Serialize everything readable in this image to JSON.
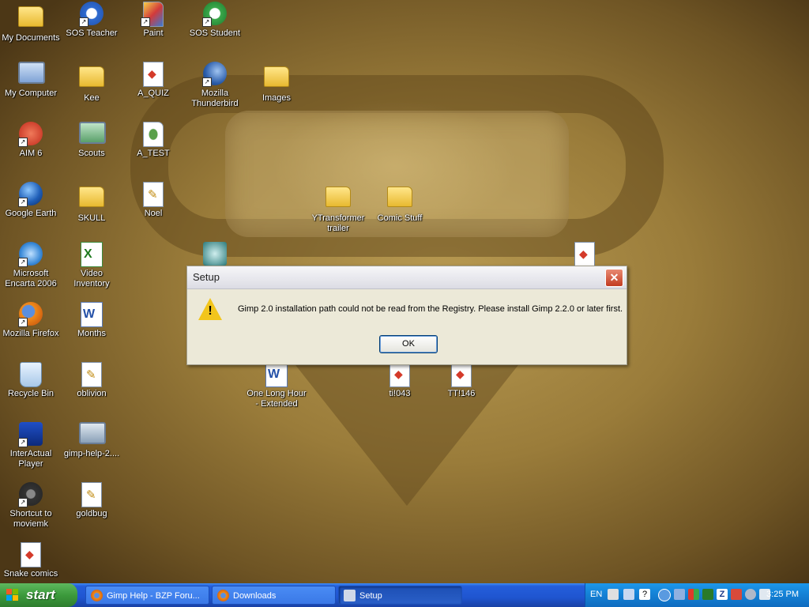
{
  "desktop": {
    "icons": [
      {
        "label": "My Documents",
        "icon": "folder-documents-icon"
      },
      {
        "label": "SOS Teacher",
        "icon": "sos-teacher-icon"
      },
      {
        "label": "Paint",
        "icon": "paint-icon"
      },
      {
        "label": "SOS Student",
        "icon": "sos-student-icon"
      },
      {
        "label": "My Computer",
        "icon": "computer-icon"
      },
      {
        "label": "Kee",
        "icon": "folder-icon"
      },
      {
        "label": "A_QUIZ",
        "icon": "media-file-icon"
      },
      {
        "label": "Mozilla\nThunderbird",
        "icon": "thunderbird-icon"
      },
      {
        "label": "Images",
        "icon": "folder-icon"
      },
      {
        "label": "AIM 6",
        "icon": "aim-icon"
      },
      {
        "label": "Scouts",
        "icon": "computer-icon"
      },
      {
        "label": "A_TEST",
        "icon": "media-player-file-icon"
      },
      {
        "label": "Google Earth",
        "icon": "google-earth-icon"
      },
      {
        "label": "SKULL",
        "icon": "folder-icon"
      },
      {
        "label": "Noel",
        "icon": "text-file-icon"
      },
      {
        "label": "YTransformer\ntrailer",
        "icon": "folder-icon"
      },
      {
        "label": "Comic Stuff",
        "icon": "folder-icon"
      },
      {
        "label": "Microsoft\nEncarta 2006",
        "icon": "encarta-icon"
      },
      {
        "label": "Video\nInventory",
        "icon": "excel-file-icon"
      },
      {
        "label": "Mozilla Firefox",
        "icon": "firefox-icon"
      },
      {
        "label": "Months",
        "icon": "word-file-icon"
      },
      {
        "label": "Recycle Bin",
        "icon": "recycle-bin-icon"
      },
      {
        "label": "oblivion",
        "icon": "text-file-icon"
      },
      {
        "label": "One Long Hour\n- Extended",
        "icon": "word-file-icon"
      },
      {
        "label": "ti!043",
        "icon": "media-file-icon"
      },
      {
        "label": "TT!146",
        "icon": "media-file-icon"
      },
      {
        "label": "InterActual\nPlayer",
        "icon": "interactual-icon"
      },
      {
        "label": "gimp-help-2....",
        "icon": "installer-icon"
      },
      {
        "label": "Shortcut to\nmoviemk",
        "icon": "movie-maker-icon"
      },
      {
        "label": "goldbug",
        "icon": "text-file-icon"
      },
      {
        "label": "Snake comics",
        "icon": "media-file-icon"
      }
    ]
  },
  "dialog": {
    "title": "Setup",
    "message": "Gimp 2.0 installation path could not be read from the Registry. Please install Gimp 2.2.0 or later first.",
    "ok_label": "OK",
    "close_label": "✕",
    "warning_mark": "!"
  },
  "taskbar": {
    "start_label": "start",
    "tasks": [
      {
        "label": "Gimp Help - BZP Foru...",
        "icon": "firefox-icon"
      },
      {
        "label": "Downloads",
        "icon": "firefox-icon"
      },
      {
        "label": "Setup",
        "icon": "setup-icon"
      }
    ],
    "tray": {
      "language": "EN",
      "clock": "3:25 PM"
    }
  },
  "colors": {
    "taskbar_blue": "#245edb",
    "start_green": "#3c9a3c",
    "tray_blue": "#1480d4",
    "dialog_bg": "#ece9d8",
    "close_red": "#c23b20",
    "warning_yellow": "#f2c51c"
  }
}
